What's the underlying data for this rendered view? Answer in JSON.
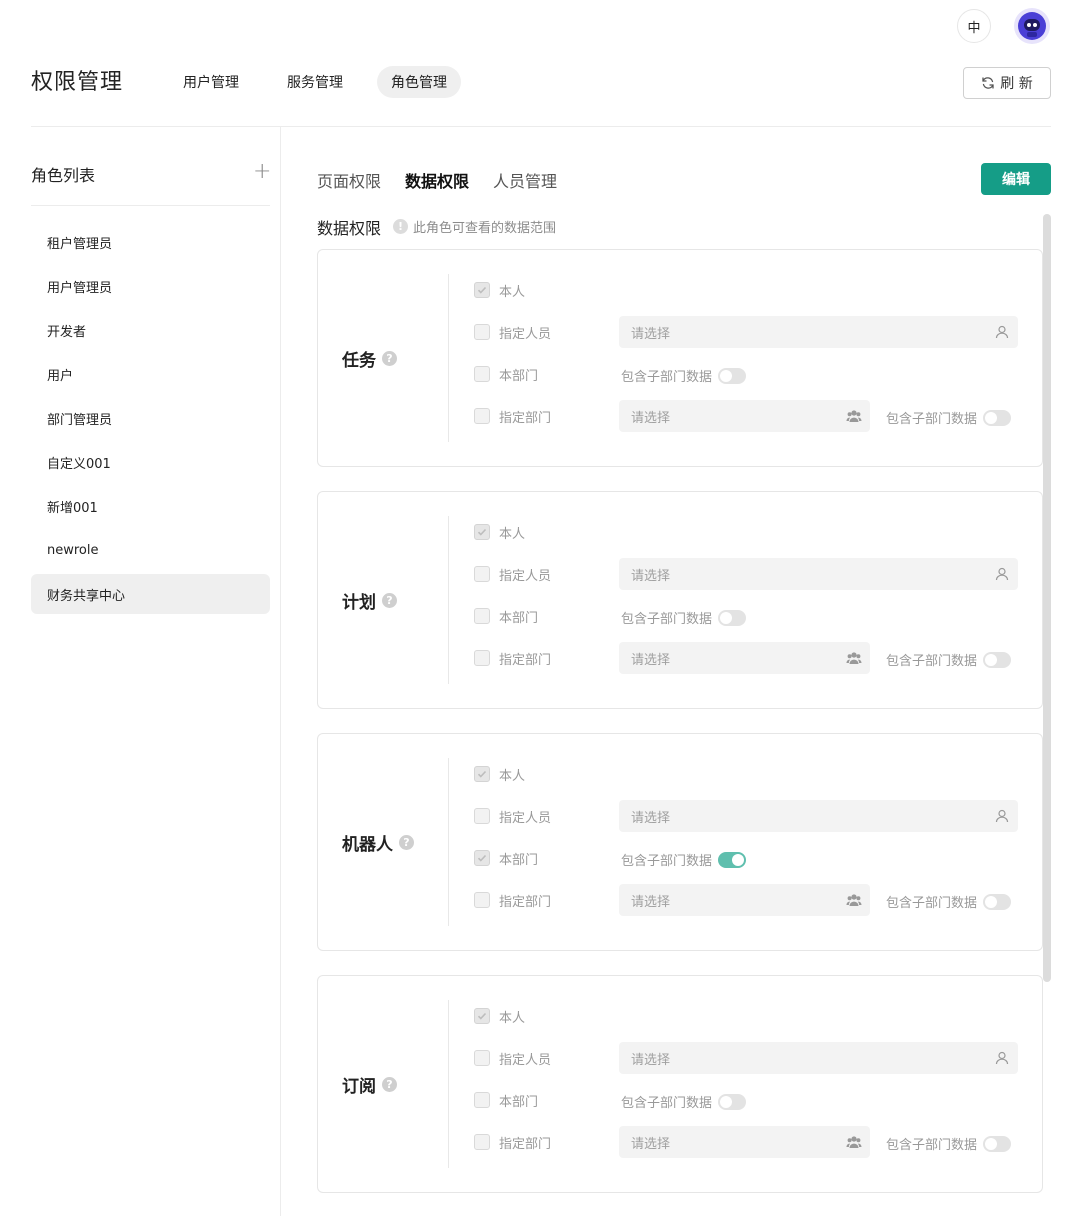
{
  "header": {
    "lang_label": "中",
    "page_title": "权限管理",
    "tabs": [
      {
        "label": "用户管理"
      },
      {
        "label": "服务管理"
      },
      {
        "label": "角色管理"
      }
    ],
    "refresh_label": "刷 新"
  },
  "sidebar": {
    "title": "角色列表",
    "add_icon": "plus-icon",
    "items": [
      {
        "label": "租户管理员"
      },
      {
        "label": "用户管理员"
      },
      {
        "label": "开发者"
      },
      {
        "label": "用户"
      },
      {
        "label": "部门管理员"
      },
      {
        "label": "自定义001"
      },
      {
        "label": "新增001"
      },
      {
        "label": "newrole"
      },
      {
        "label": "财务共享中心",
        "selected": true
      }
    ]
  },
  "content": {
    "tabs": [
      {
        "label": "页面权限"
      },
      {
        "label": "数据权限",
        "active": true
      },
      {
        "label": "人员管理"
      }
    ],
    "edit_label": "编辑",
    "section_title": "数据权限",
    "section_hint": "此角色可查看的数据范围",
    "row_labels": {
      "self": "本人",
      "person": "指定人员",
      "dept": "本部门",
      "spec_dept": "指定部门"
    },
    "placeholder": "请选择",
    "include_sub": "包含子部门数据",
    "accent": "#159d87",
    "cards": [
      {
        "name": "任务",
        "self": true,
        "person": false,
        "dept": false,
        "dept_include": false,
        "spec_dept": false,
        "spec_include": false
      },
      {
        "name": "计划",
        "self": true,
        "person": false,
        "dept": false,
        "dept_include": false,
        "spec_dept": false,
        "spec_include": false
      },
      {
        "name": "机器人",
        "self": true,
        "person": false,
        "dept": true,
        "dept_include": true,
        "spec_dept": false,
        "spec_include": false
      },
      {
        "name": "订阅",
        "self": true,
        "person": false,
        "dept": false,
        "dept_include": false,
        "spec_dept": false,
        "spec_include": false
      }
    ]
  }
}
